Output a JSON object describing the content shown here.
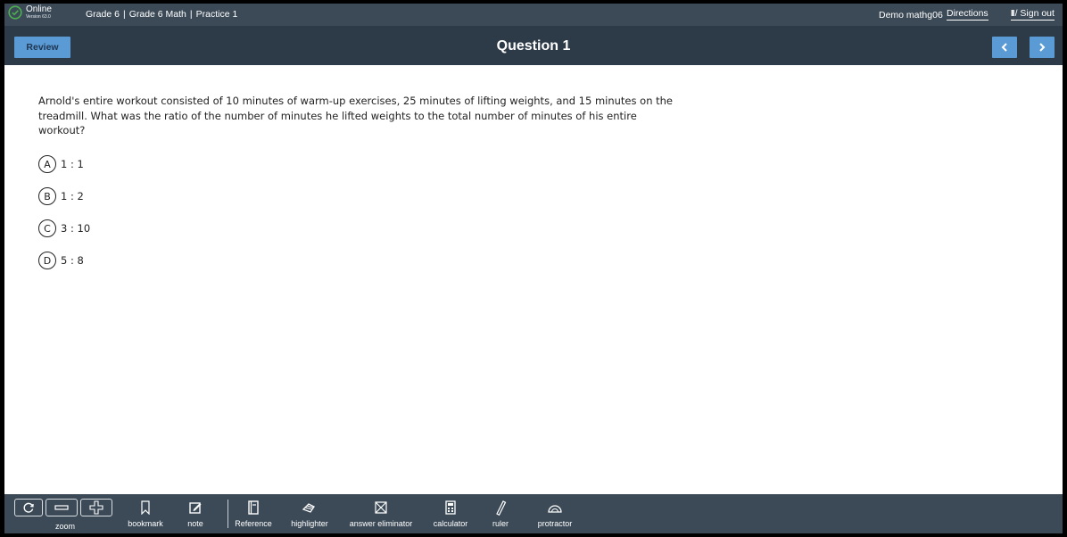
{
  "status": {
    "label": "Online",
    "version": "Version 63.0",
    "accent": "#4caf50"
  },
  "breadcrumb": [
    "Grade 6",
    "Grade 6 Math",
    "Practice 1"
  ],
  "user": {
    "name": "Demo mathg06"
  },
  "links": {
    "directions": "Directions",
    "signout": "/ Sign out"
  },
  "header": {
    "review_label": "Review",
    "title": "Question 1",
    "prev_icon": "chevron-left-icon",
    "next_icon": "chevron-right-icon"
  },
  "question": {
    "text": "Arnold's entire workout consisted of 10 minutes of warm-up exercises, 25 minutes of lifting weights, and 15 minutes on the treadmill. What was the ratio of the number of minutes he lifted weights to the total number of minutes of his entire workout?",
    "options": [
      {
        "letter": "A",
        "text": "1 : 1"
      },
      {
        "letter": "B",
        "text": "1 : 2"
      },
      {
        "letter": "C",
        "text": "3 : 10"
      },
      {
        "letter": "D",
        "text": "5 : 8"
      }
    ]
  },
  "toolbar": {
    "zoom": "zoom",
    "bookmark": "bookmark",
    "note": "note",
    "reference": "Reference",
    "highlighter": "highlighter",
    "answer_eliminator": "answer eliminator",
    "calculator": "calculator",
    "ruler": "ruler",
    "protractor": "protractor"
  },
  "colors": {
    "topbar": "#3c4a57",
    "header": "#2d3a47",
    "button": "#5b9bd5"
  }
}
